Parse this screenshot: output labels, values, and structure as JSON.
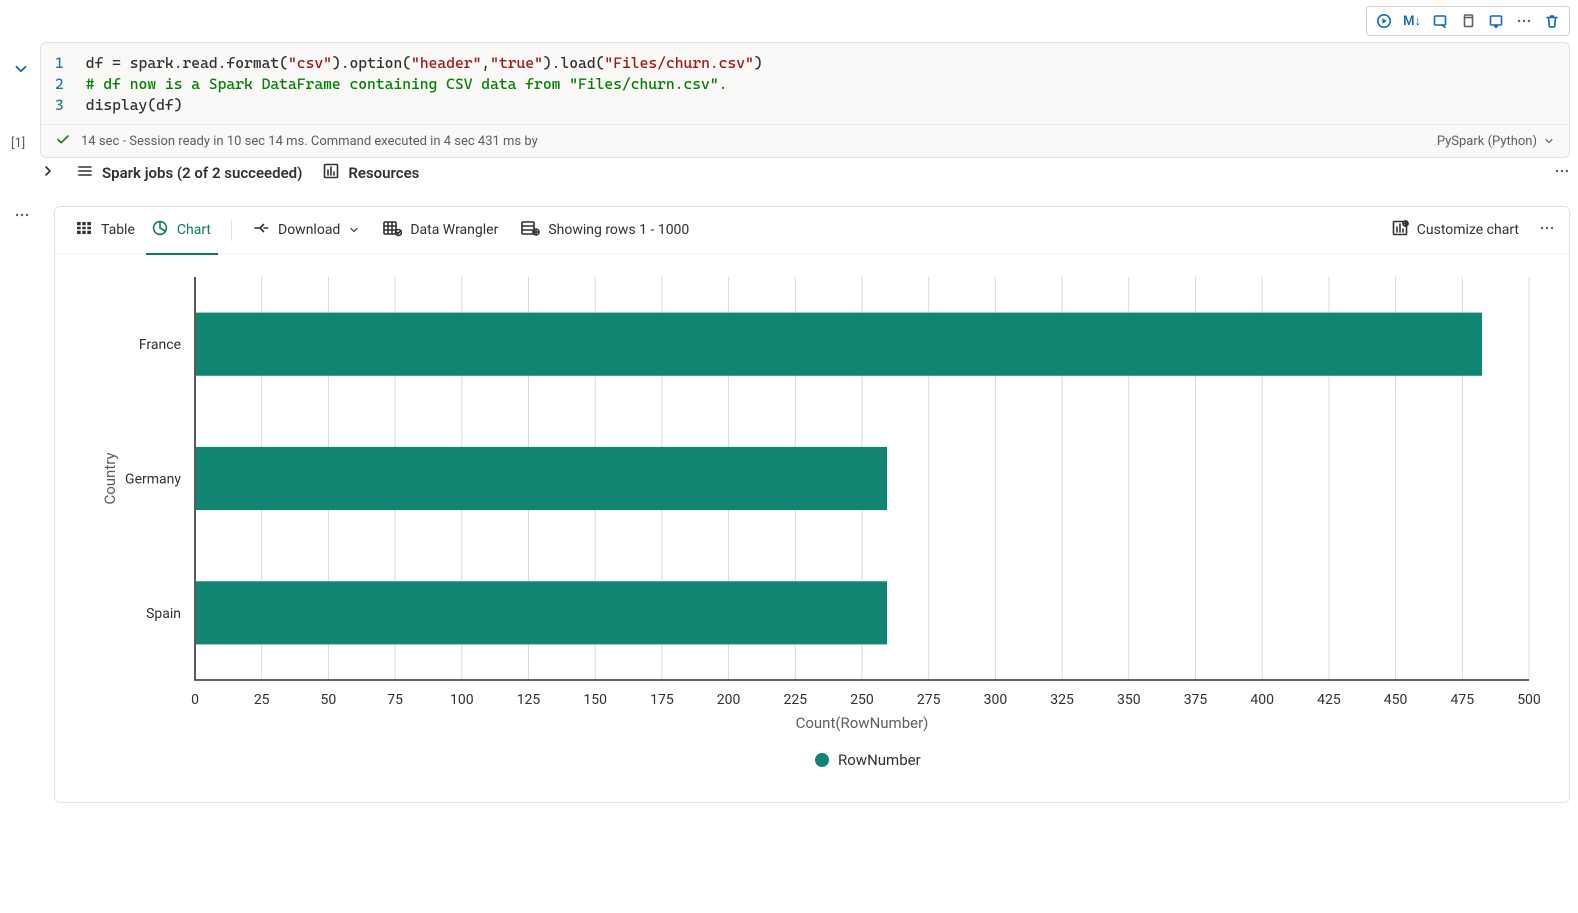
{
  "toolbar": {
    "ml_label": "M↓"
  },
  "code": {
    "line_numbers": [
      "1",
      "2",
      "3"
    ]
  },
  "exec": {
    "index": "[1]",
    "status_prefix": "14 sec",
    "status_rest": " - Session ready in 10 sec 14 ms. Command executed in 4 sec 431 ms by",
    "language": "PySpark (Python)"
  },
  "sections": {
    "spark_jobs": "Spark jobs (2 of 2 succeeded)",
    "resources": "Resources"
  },
  "output_toolbar": {
    "table": "Table",
    "chart": "Chart",
    "download": "Download",
    "data_wrangler": "Data Wrangler",
    "rows": "Showing rows 1 - 1000",
    "customize": "Customize chart"
  },
  "chart_data": {
    "type": "bar",
    "orientation": "horizontal",
    "categories": [
      "France",
      "Germany",
      "Spain"
    ],
    "values": [
      482,
      259,
      259
    ],
    "xlabel": "Count(RowNumber)",
    "ylabel": "Country",
    "xlim": [
      0,
      500
    ],
    "xticks": [
      0,
      25,
      50,
      75,
      100,
      125,
      150,
      175,
      200,
      225,
      250,
      275,
      300,
      325,
      350,
      375,
      400,
      425,
      450,
      475,
      500
    ],
    "legend": [
      "RowNumber"
    ],
    "series_name": "RowNumber"
  }
}
